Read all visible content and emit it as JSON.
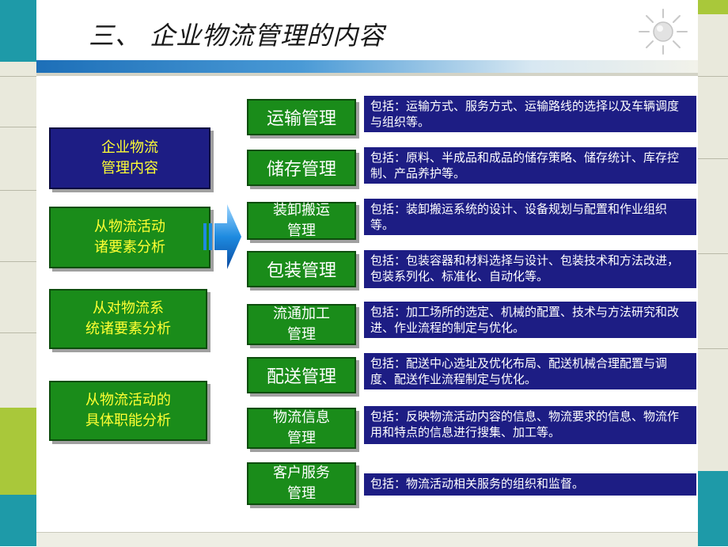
{
  "slide": {
    "title": "三、 企业物流管理的内容"
  },
  "left_boxes": [
    {
      "label": "企业物流\n管理内容"
    },
    {
      "label": "从物流活动\n诸要素分析"
    },
    {
      "label": "从对物流系\n统诸要素分析"
    },
    {
      "label": "从物流活动的\n具体职能分析"
    }
  ],
  "management_items": [
    {
      "name": "运输管理",
      "desc": "包括：运输方式、服务方式、运输路线的选择以及车辆调度与组织等。"
    },
    {
      "name": "储存管理",
      "desc": "包括：原料、半成品和成品的储存策略、储存统计、库存控制、产品养护等。"
    },
    {
      "name": "装卸搬运\n管理",
      "desc": "包括：装卸搬运系统的设计、设备规划与配置和作业组织等。"
    },
    {
      "name": "包装管理",
      "desc": "包括：包装容器和材料选择与设计、包装技术和方法改进，包装系列化、标准化、自动化等。"
    },
    {
      "name": "流通加工\n管理",
      "desc": "包括：加工场所的选定、机械的配置、技术与方法研究和改进、作业流程的制定与优化。"
    },
    {
      "name": "配送管理",
      "desc": "包括：配送中心选址及优化布局、配送机械合理配置与调度、配送作业流程制定与优化。"
    },
    {
      "name": "物流信息\n管理",
      "desc": "包括：反映物流活动内容的信息、物流要求的信息、物流作用和特点的信息进行搜集、加工等。"
    },
    {
      "name": "客户服务\n管理",
      "desc": "包括：物流活动相关服务的组织和监督。"
    }
  ],
  "colors": {
    "green": "#1a8c1a",
    "navy": "#1d1d84",
    "yellow_text": "#ffff33",
    "teal": "#1e9aa8",
    "lime": "#a9c83a"
  },
  "icons": {
    "arrow": "right-arrow-icon",
    "sun": "sun-decoration-icon"
  }
}
